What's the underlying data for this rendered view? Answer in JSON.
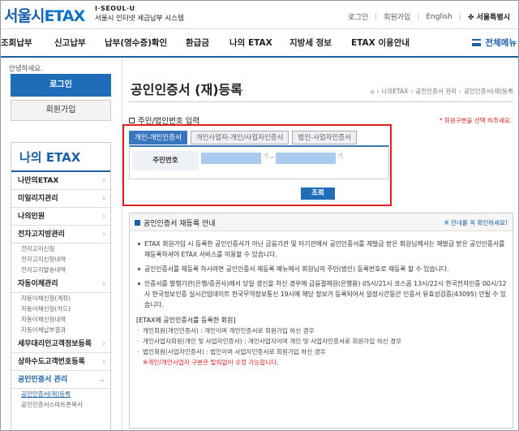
{
  "header": {
    "logo_text": "서울시",
    "logo_etax": "ETAX",
    "logo_sub": "I·SEOUL·U",
    "logo_desc": "서울시 인터넷 세금납부 시스템",
    "util": [
      "로그인",
      "회원가입",
      "English"
    ],
    "seoul_brand": "서울특별시"
  },
  "gnb": {
    "items": [
      "조회납부",
      "신고납부",
      "납부(영수증)확인",
      "환급금",
      "나의 ETAX",
      "지방세 정보",
      "ETAX 이용안내"
    ],
    "all_menu": "전체메뉴"
  },
  "sidebar": {
    "greeting": "안녕하세요.",
    "login": "로그인",
    "join": "회원가입",
    "title": "나의 ETAX",
    "nav": [
      {
        "label": "나만의ETAX",
        "subs": []
      },
      {
        "label": "미일리지관리",
        "subs": []
      },
      {
        "label": "나의민원",
        "subs": []
      },
      {
        "label": "전자고지방관리",
        "subs": [
          "전자고지신청",
          "전자고지신청내역",
          "전자고지발송내역"
        ]
      },
      {
        "label": "자동이체관리",
        "subs": [
          "자동이체신청(계좌)",
          "자동이체신청(카드)",
          "자동이체신청내역",
          "자동이체납부결과"
        ]
      },
      {
        "label": "세무대리인고객정보등록",
        "subs": []
      },
      {
        "label": "상하수도고객번호등록",
        "subs": []
      },
      {
        "label": "공인인증서 관리",
        "subs": [
          "공인인증서(재)등록",
          "공인인증서스마트폰복사"
        ]
      }
    ]
  },
  "main": {
    "title": "공인인증서 (재)등록",
    "breadcrumb": [
      "나의ETAX",
      "공인인증서 관리",
      "공인인증서(재)등록"
    ],
    "section_label": "주민/법인번호 입력",
    "section_note": "* 회원구분을 선택 하주세요.",
    "tabs": [
      "개인-개인인증서",
      "개인사업자-개인/사업자인증서",
      "법인-사업자인증서"
    ],
    "rrn_label": "주민번호",
    "rrn_dash": "-",
    "query_button": "조회",
    "notice": {
      "title": "공인인증서 재등록 안내",
      "link": "※ 안내를 꼭 확인하세요!",
      "paragraphs": [
        "ETAX 회원가입 시 등록한 공인인증서가 아닌 금융기관 및 타기관에서 공인인증서를 재발급 받은 회원님께서는 재발급 받은 공인인증서를 재등록하셔야 ETAX 서비스를 이용할 수 있습니다.",
        "공인인증서를 재등록 하시려면 공인인증서 재등록 메뉴에서 회원님의 주민(법인) 등록번호로 재등록 할 수 있습니다.",
        "인증서를 발행기관(은행/증권사)에서 당일 갱신을 하신 경우에 금융결제원(은행용) 05시/21시 코스콤 13시/22시 한국전자인증 00시/12시 한국정보인증 실시간업데이트 한국무역정보통신 19시에 해당 정보가 등록되어서 일정시간동안 인증서 유효성검증(43095) 안될 수 있습니다."
      ],
      "reg_head": "[ETAX에 공인인증서를 등록한 회원]",
      "regs": [
        "개인회원(개인인증서) : 개인이며 개인인증서로 회원가입 하신 경우",
        "개인사업자회원(개인 및 사업자인증서) : 개인사업자이며 개인 및 사업자인증서로 회원가입 하신 경우",
        "법인회원(사업자인증서) : 법인이며 사업자인증서로 회원가입 하신 경우"
      ],
      "reg_note": "※개인/개인사업자 구분은 탈퇴없이 수정 가능합니다."
    }
  },
  "colors": {
    "brand": "#1a5fa8",
    "button": "#1f6cb8",
    "highlight": "#e02020",
    "input_fill": "#a9cbef"
  }
}
